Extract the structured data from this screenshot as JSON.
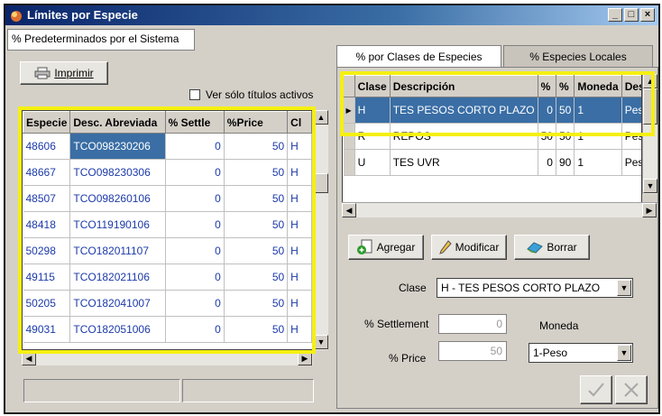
{
  "window": {
    "title": "Límites por Especie"
  },
  "left": {
    "panel_label": "% Predeterminados por el Sistema",
    "print_button": "Imprimir",
    "checkbox_label": "Ver sólo títulos activos",
    "columns": [
      "Especie",
      "Desc. Abreviada",
      "% Settle",
      "%Price",
      "Cl"
    ],
    "rows": [
      {
        "especie": "48606",
        "desc": "TCO098230206",
        "settle": "0",
        "price": "50",
        "cl": "H"
      },
      {
        "especie": "48667",
        "desc": "TCO098230306",
        "settle": "0",
        "price": "50",
        "cl": "H"
      },
      {
        "especie": "48507",
        "desc": "TCO098260106",
        "settle": "0",
        "price": "50",
        "cl": "H"
      },
      {
        "especie": "48418",
        "desc": "TCO119190106",
        "settle": "0",
        "price": "50",
        "cl": "H"
      },
      {
        "especie": "50298",
        "desc": "TCO182011107",
        "settle": "0",
        "price": "50",
        "cl": "H"
      },
      {
        "especie": "49115",
        "desc": "TCO182021106",
        "settle": "0",
        "price": "50",
        "cl": "H"
      },
      {
        "especie": "50205",
        "desc": "TCO182041007",
        "settle": "0",
        "price": "50",
        "cl": "H"
      },
      {
        "especie": "49031",
        "desc": "TCO182051006",
        "settle": "0",
        "price": "50",
        "cl": "H"
      }
    ]
  },
  "right": {
    "tabs": [
      "% por Clases de Especies",
      "% Especies Locales"
    ],
    "columns": [
      "Clase",
      "Descripción",
      "%",
      "%",
      "Moneda",
      "Desc."
    ],
    "rows": [
      {
        "clase": "H",
        "desc": "TES PESOS CORTO PLAZO",
        "p1": "0",
        "p2": "50",
        "moneda": "1",
        "descm": "Peso"
      },
      {
        "clase": "R",
        "desc": "REPOS",
        "p1": "50",
        "p2": "50",
        "moneda": "1",
        "descm": "Peso"
      },
      {
        "clase": "U",
        "desc": "TES UVR",
        "p1": "0",
        "p2": "90",
        "moneda": "1",
        "descm": "Peso"
      }
    ],
    "buttons": {
      "add": "Agregar",
      "modify": "Modificar",
      "delete": "Borrar"
    },
    "form": {
      "clase_label": "Clase",
      "clase_value": "H - TES PESOS CORTO PLAZO",
      "settlement_label": "% Settlement",
      "settlement_value": "0",
      "price_label": "% Price",
      "price_value": "50",
      "moneda_label": "Moneda",
      "moneda_value": "1-Peso"
    },
    "action_icons": {
      "confirm": "check-icon",
      "cancel": "x-icon"
    }
  },
  "colors": {
    "highlight": "#f5f011",
    "selection": "#3a6ea5",
    "link_text": "#1c3aa9"
  }
}
